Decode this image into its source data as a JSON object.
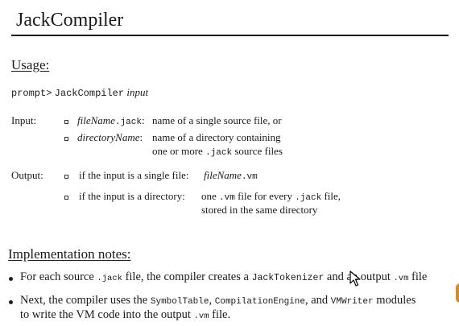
{
  "title": "JackCompiler",
  "usage": {
    "heading": "Usage:",
    "prompt": "prompt>",
    "command": "JackCompiler",
    "arg": "input"
  },
  "input": {
    "label": "Input:",
    "items": [
      {
        "name_italic": "fileName",
        "name_ext": ".jack",
        "colon": ":",
        "desc": "name of a single source file, or"
      },
      {
        "name_italic": "directoryName",
        "colon": ":",
        "desc1": "name of a directory containing",
        "desc2_pre": "one or more",
        "desc2_code": ".jack",
        "desc2_post": "source files"
      }
    ]
  },
  "output": {
    "label": "Output:",
    "items": [
      {
        "cond": "if the input is a single file:",
        "res_italic": "fileName",
        "res_ext": ".vm"
      },
      {
        "cond": "if the input is a directory:",
        "line1_pre": "one",
        "line1_code1": ".vm",
        "line1_mid": "file for every",
        "line1_code2": ".jack",
        "line1_post": "file,",
        "line2": "stored in the same directory"
      }
    ]
  },
  "notes": {
    "heading": "Implementation notes:",
    "bullet1": {
      "t1": "For each source",
      "c1": ".jack",
      "t2": "file, the compiler creates a",
      "c2": "JackTokenizer",
      "t3": "and an output",
      "c3": ".vm",
      "t4": "file"
    },
    "bullet2": {
      "t1": "Next, the compiler uses the",
      "c1": "SymbolTable",
      "t2": ",",
      "c2": "CompilationEngine",
      "t3": ", and",
      "c3": "VMWriter",
      "t4": "modules",
      "line2_pre": "to write the VM code into the output",
      "line2_code": ".vm",
      "line2_post": "file."
    }
  },
  "colors": {
    "text": "#1a1a1a",
    "rule": "#000000",
    "background": "#ffffff"
  }
}
